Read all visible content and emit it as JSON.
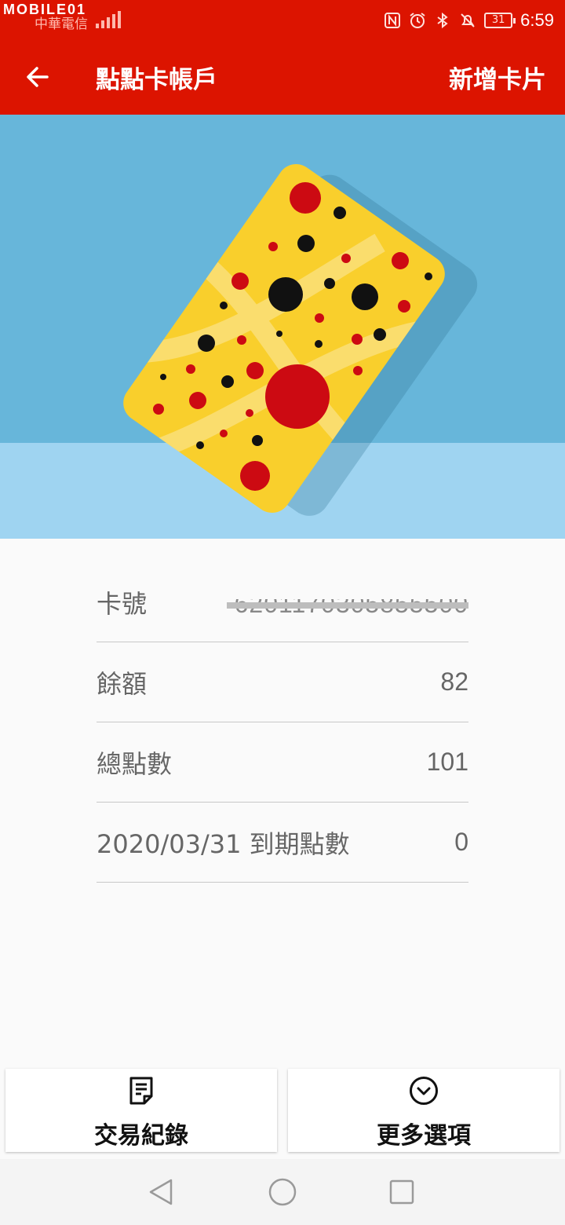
{
  "status_bar": {
    "watermark": "MOBILE01",
    "carrier": "中華電信",
    "battery": "31",
    "time": "6:59"
  },
  "app_bar": {
    "title": "點點卡帳戶",
    "add_card_label": "新增卡片"
  },
  "card_info": {
    "card_number_label": "卡號",
    "card_number_value": "6201170305855500",
    "balance_label": "餘額",
    "balance_value": "82",
    "total_points_label": "總點數",
    "total_points_value": "101",
    "expiring_label": "2020/03/31 到期點數",
    "expiring_value": "0"
  },
  "actions": {
    "transactions_label": "交易紀錄",
    "more_options_label": "更多選項"
  },
  "colors": {
    "app_bar": "#dc1400",
    "hero_bg_top": "#67b6da",
    "hero_bg_bottom": "#9fd4f1",
    "card_yellow": "#f9cf2c",
    "dot_red": "#cc0a12"
  },
  "icons": {
    "back": "arrow-left-icon",
    "transactions": "document-icon",
    "more": "chevron-down-circle-icon",
    "nav_back": "triangle-back-icon",
    "nav_home": "circle-home-icon",
    "nav_recent": "square-recent-icon"
  }
}
